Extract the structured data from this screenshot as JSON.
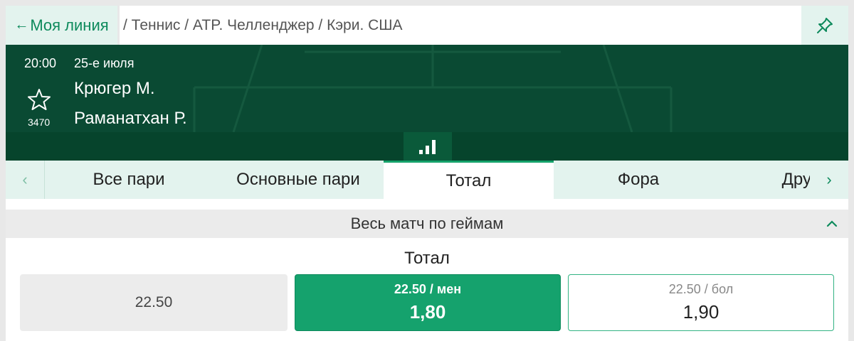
{
  "topbar": {
    "back_label": "Моя линия",
    "back_arrow": "←",
    "breadcrumb": "/ Теннис / ATP. Челленджер / Кэри. США",
    "pin_icon": "pin-icon"
  },
  "match": {
    "time": "20:00",
    "date": "25-е июля",
    "player1": "Крюгер М.",
    "player2": "Раманатхан Р.",
    "id": "3470"
  },
  "tabs": {
    "prev_arrow": "‹",
    "next_arrow": "›",
    "items": [
      {
        "label": "Все пари"
      },
      {
        "label": "Основные пари"
      },
      {
        "label": "Тотал"
      },
      {
        "label": "Фора"
      },
      {
        "label": "Дру"
      }
    ],
    "active": "Тотал"
  },
  "section": {
    "title": "Весь матч по геймам",
    "market_title": "Тотал"
  },
  "odds": {
    "base": "22.50",
    "under": {
      "label": "22.50 / мен",
      "value": "1,80"
    },
    "over": {
      "label": "22.50 / бол",
      "value": "1,90"
    }
  },
  "colors": {
    "accent": "#15a26d",
    "header_bg": "#0a4a33",
    "tab_bg": "#e3f3ee"
  }
}
